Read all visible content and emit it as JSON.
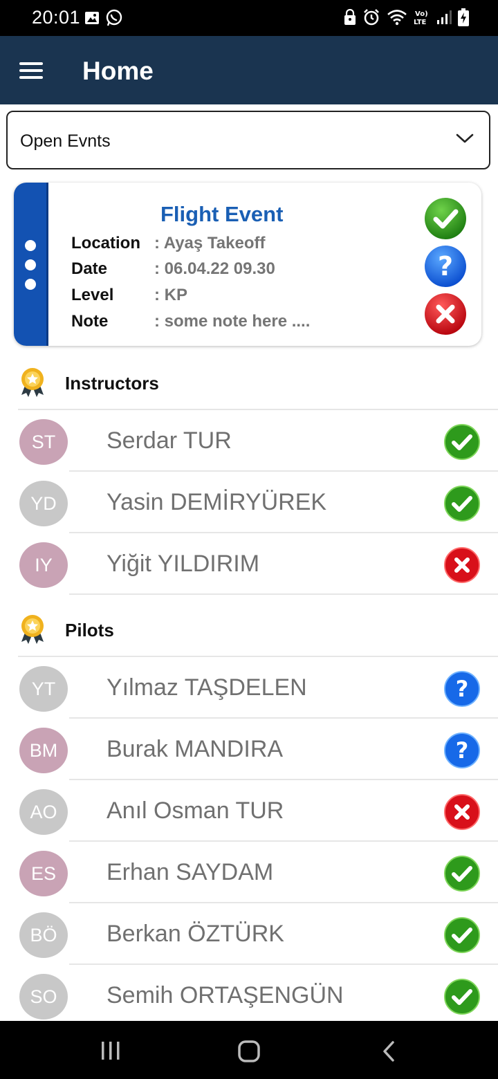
{
  "status_bar": {
    "time": "20:01"
  },
  "app_bar": {
    "title": "Home"
  },
  "filter": {
    "selected": "Open Evnts"
  },
  "event": {
    "title": "Flight Event",
    "details": [
      {
        "label": "Location",
        "value": ": Ayaş Takeoff"
      },
      {
        "label": "Date",
        "value": ": 06.04.22 09.30"
      },
      {
        "label": "Level",
        "value": ": KP"
      },
      {
        "label": "Note",
        "value": ": some note here ...."
      }
    ]
  },
  "sections": [
    {
      "title": "Instructors",
      "people": [
        {
          "initials": "ST",
          "name": "Serdar TUR",
          "status": "accepted"
        },
        {
          "initials": "YD",
          "name": "Yasin DEMİRYÜREK",
          "status": "accepted"
        },
        {
          "initials": "IY",
          "name": "Yiğit YILDIRIM",
          "status": "declined"
        }
      ]
    },
    {
      "title": "Pilots",
      "people": [
        {
          "initials": "YT",
          "name": "Yılmaz TAŞDELEN",
          "status": "pending"
        },
        {
          "initials": "BM",
          "name": "Burak MANDIRA",
          "status": "pending"
        },
        {
          "initials": "AO",
          "name": "Anıl Osman TUR",
          "status": "declined"
        },
        {
          "initials": "ES",
          "name": "Erhan SAYDAM",
          "status": "accepted"
        },
        {
          "initials": "BÖ",
          "name": "Berkan ÖZTÜRK",
          "status": "accepted"
        },
        {
          "initials": "SO",
          "name": "Semih ORTAŞENGÜN",
          "status": "accepted"
        }
      ]
    }
  ],
  "colors": {
    "app_bar": "#1a3450",
    "accent_blue": "#1a5fb4",
    "accepted": "#2e9a1c",
    "pending": "#1769e8",
    "declined": "#d8101a",
    "avatar_pink": "#c9a3b5",
    "avatar_grey": "#c8c8c8"
  }
}
